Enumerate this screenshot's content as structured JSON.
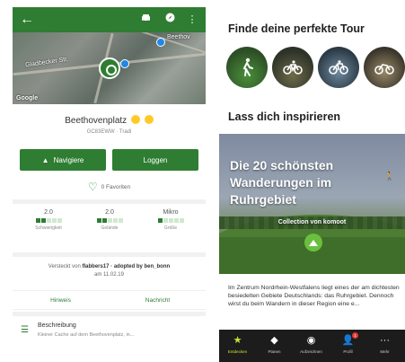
{
  "left": {
    "appbar": {
      "back_icon": "arrow-left-icon",
      "car_icon": "car-icon",
      "compass_icon": "compass-icon",
      "more_icon": "more-vert-icon",
      "color": "#2e7d32"
    },
    "map": {
      "street_label": "Gladbecker Str.",
      "street_label_2": "Beethov",
      "google": "Google"
    },
    "cache": {
      "title": "Beethovenplatz",
      "code": "GC83EWW · Tradi"
    },
    "buttons": {
      "navigate": "Navigiere",
      "log": "Loggen"
    },
    "favorites": "0 Favoriten",
    "stats": [
      {
        "value": "2.0",
        "label": "Schwierigkeit",
        "level": 2
      },
      {
        "value": "2.0",
        "label": "Gelände",
        "level": 2
      },
      {
        "value": "Mikro",
        "label": "Größe",
        "level": 1
      }
    ],
    "owner": {
      "prefix": "Versteckt von",
      "name": "flabbers17 · adopted by ben_bonn",
      "date": "am 11.02.19"
    },
    "actions": {
      "hint": "Hinweis",
      "message": "Nachricht"
    },
    "description": {
      "title": "Beschreibung",
      "snippet": "Kleiner Cache auf dem Beethovenplatz, in..."
    }
  },
  "right": {
    "tour_heading": "Finde deine perfekte Tour",
    "tour_chips": [
      {
        "icon": "hiking-icon"
      },
      {
        "icon": "bike-icon"
      },
      {
        "icon": "road-bike-icon"
      },
      {
        "icon": "mountain-bike-icon"
      }
    ],
    "inspire_heading": "Lass dich inspirieren",
    "card": {
      "title": "Die 20 schönsten Wanderungen im Ruhrgebiet",
      "collection": "Collection von komoot"
    },
    "paragraph": "Im Zentrum Nordrhein-Westfalens liegt eines der am dichtesten besiedelten Gebiete Deutschlands: das Ruhrgebiet. Dennoch wirst du beim Wandern in dieser Region eine e...",
    "tabs": [
      {
        "label": "Entdecken",
        "icon": "star-icon",
        "active": true
      },
      {
        "label": "Planen",
        "icon": "navigation-icon",
        "active": false
      },
      {
        "label": "Aufzeichnen",
        "icon": "record-icon",
        "active": false
      },
      {
        "label": "Profil",
        "icon": "profile-icon",
        "active": false,
        "badge": "1"
      },
      {
        "label": "Mehr",
        "icon": "more-icon",
        "active": false
      }
    ],
    "accent": "#c5e13a"
  }
}
